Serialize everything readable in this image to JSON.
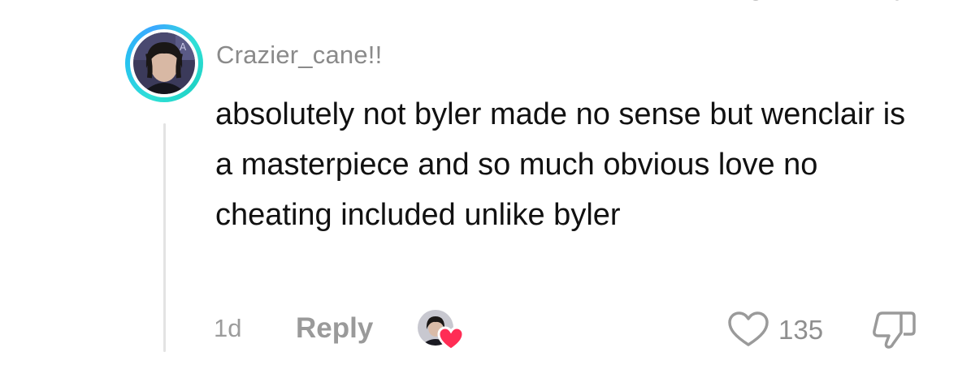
{
  "comment": {
    "username": "Crazier_cane!!",
    "text": "absolutely not byler made no sense but wenclair is a masterpiece and so much obvious love no cheating included unlike byler",
    "timestamp": "1d",
    "reply_label": "Reply",
    "like_count": "135"
  },
  "colors": {
    "avatar_ring": "#2fe0d6",
    "heart_badge": "#ff2d55",
    "muted_text": "#8a8a8a"
  },
  "icons": {
    "like": "heart-outline-icon",
    "dislike": "thumbs-down-outline-icon",
    "creator_liked": "heart-filled-icon"
  }
}
